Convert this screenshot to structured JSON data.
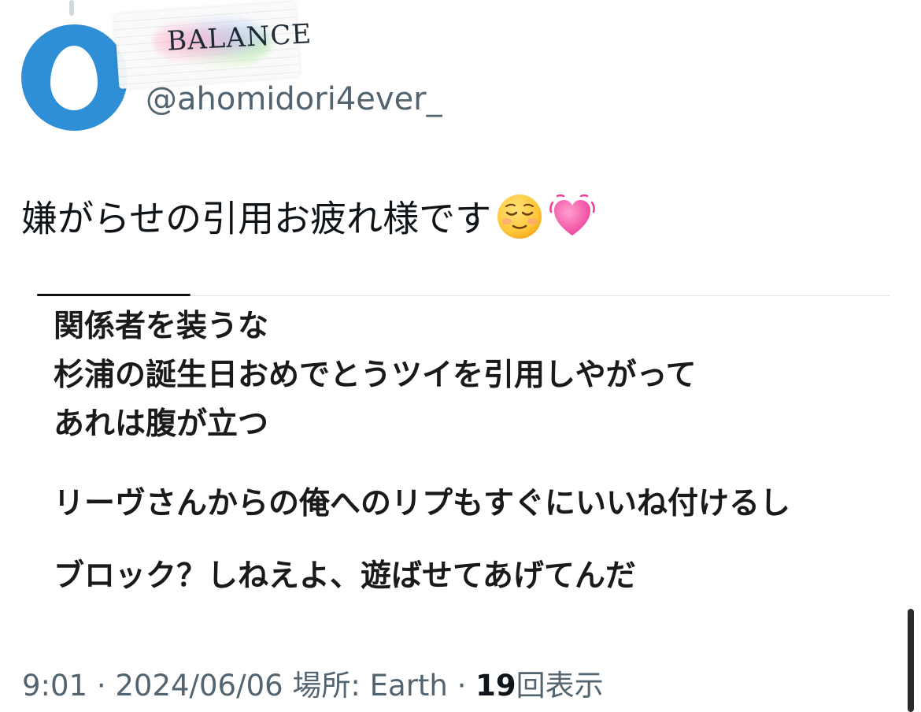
{
  "user": {
    "display_name": "BALANCE",
    "handle": "@ahomidori4ever_"
  },
  "tweet": {
    "text": "嫌がらせの引用お疲れ様です",
    "emojis": [
      "relieved-face-emoji",
      "heart-emoji"
    ]
  },
  "quoted_image": {
    "lines": [
      "関係者を装うな",
      "杉浦の誕生日おめでとうツイを引用しやがって",
      "あれは腹が立つ",
      "リーヴさんからの俺へのリプもすぐにいいね付けるし",
      "ブロック？しねえよ、遊ばせてあげてんだ"
    ]
  },
  "meta": {
    "time": "9:01",
    "separator": "·",
    "date": "2024/06/06",
    "location": "場所: Earth",
    "views_count": "19",
    "views_label": "回表示"
  },
  "colors": {
    "avatar_bg": "#2f8fd6",
    "secondary_text": "#536471",
    "primary_text": "#0f1419"
  }
}
